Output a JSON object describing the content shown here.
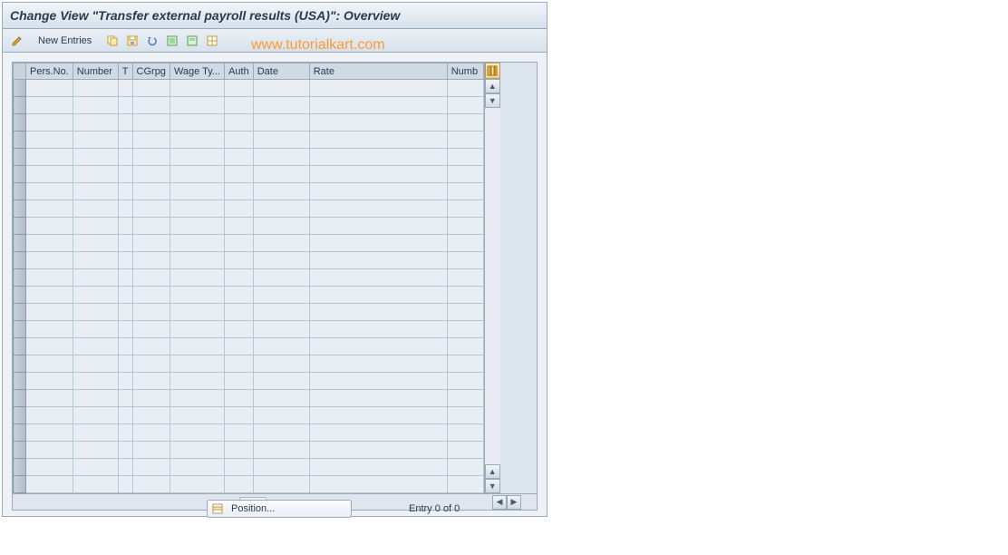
{
  "title": "Change View \"Transfer external payroll results (USA)\": Overview",
  "toolbar": {
    "new_entries_label": "New Entries"
  },
  "watermark": "www.tutorialkart.com",
  "table": {
    "columns": [
      "Pers.No.",
      "Number",
      "T",
      "CGrpg",
      "Wage Ty...",
      "Auth",
      "Date",
      "Rate",
      "Numb"
    ],
    "empty_row_count": 24
  },
  "footer": {
    "position_label": "Position...",
    "entry_status": "Entry 0 of 0"
  },
  "icons": {
    "pencil": "pencil-icon",
    "copy": "copy-icon",
    "save": "save-icon",
    "undo": "undo-icon",
    "select_all": "select-all-icon",
    "deselect": "deselect-icon",
    "print": "print-icon"
  }
}
